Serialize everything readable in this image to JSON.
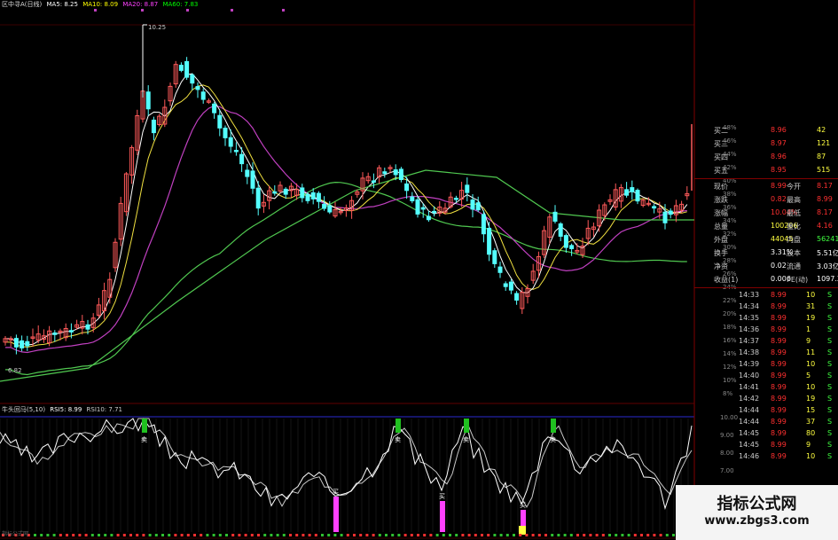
{
  "main_chart": {
    "legend": {
      "name": "区中寻A(日线)",
      "ma5": "MA5: 8.25",
      "ma10": "MA10: 8.09",
      "ma20": "MA20: 8.87",
      "ma60": "MA60: 7.83"
    },
    "high_annotation": "10.25",
    "low_annotation": "6.82",
    "colors": {
      "up": "#ff5a5a",
      "down": "#54ffff",
      "ma5": "#ffffff",
      "ma10": "#f0e040",
      "ma20": "#c040c0",
      "ma60": "#50c850",
      "ma5_label": "#ffffff",
      "ma10_label": "#ffff00",
      "ma20_label": "#ff40ff",
      "ma60_label": "#00ff00"
    }
  },
  "pct_axis": [
    "48%",
    "46%",
    "44%",
    "42%",
    "40%",
    "38%",
    "36%",
    "34%",
    "32%",
    "30%",
    "28%",
    "26%",
    "24%",
    "22%",
    "20%",
    "18%",
    "16%",
    "14%",
    "12%",
    "10%",
    "8%"
  ],
  "rsi_axis": [
    "10.00",
    "9.00",
    "8.00",
    "7.00",
    "6.00",
    "5.00"
  ],
  "quote_panel": {
    "bids": [
      {
        "label": "买二",
        "price": "8.96",
        "vol": "42"
      },
      {
        "label": "买三",
        "price": "8.97",
        "vol": "121"
      },
      {
        "label": "买四",
        "price": "8.96",
        "vol": "87"
      },
      {
        "label": "买五",
        "price": "8.95",
        "vol": "515"
      }
    ],
    "stats": [
      {
        "l1": "现价",
        "v1": "8.99",
        "l2": "今开",
        "v2": "8.17"
      },
      {
        "l1": "涨跌",
        "v1": "0.82",
        "l2": "最高",
        "v2": "8.99"
      },
      {
        "l1": "涨幅",
        "v1": "10.04%",
        "l2": "最低",
        "v2": "8.17"
      },
      {
        "l1": "总量",
        "v1": "100206",
        "l2": "量比",
        "v2": "4.16"
      },
      {
        "l1": "外盘",
        "v1": "44045",
        "l2": "内盘",
        "v2": "56241"
      },
      {
        "l1": "换手",
        "v1": "3.31%",
        "l2": "股本",
        "v2": "5.51亿"
      },
      {
        "l1": "净资",
        "v1": "0.02",
        "l2": "流通",
        "v2": "3.03亿"
      },
      {
        "l1": "收益(1)",
        "v1": "0.006",
        "l2": "PE(动)",
        "v2": "1097.2"
      }
    ],
    "ticks": [
      {
        "time": "14:33",
        "price": "8.99",
        "vol": "10",
        "side": "S"
      },
      {
        "time": "14:34",
        "price": "8.99",
        "vol": "31",
        "side": "S"
      },
      {
        "time": "14:35",
        "price": "8.99",
        "vol": "19",
        "side": "S"
      },
      {
        "time": "14:36",
        "price": "8.99",
        "vol": "1",
        "side": "S"
      },
      {
        "time": "14:37",
        "price": "8.99",
        "vol": "9",
        "side": "S"
      },
      {
        "time": "14:38",
        "price": "8.99",
        "vol": "11",
        "side": "S"
      },
      {
        "time": "14:39",
        "price": "8.99",
        "vol": "10",
        "side": "S"
      },
      {
        "time": "14:40",
        "price": "8.99",
        "vol": "5",
        "side": "S"
      },
      {
        "time": "14:41",
        "price": "8.99",
        "vol": "10",
        "side": "S"
      },
      {
        "time": "14:42",
        "price": "8.99",
        "vol": "19",
        "side": "S"
      },
      {
        "time": "14:44",
        "price": "8.99",
        "vol": "15",
        "side": "S"
      },
      {
        "time": "14:44",
        "price": "8.99",
        "vol": "37",
        "side": "S"
      },
      {
        "time": "14:45",
        "price": "8.99",
        "vol": "80",
        "side": "S"
      },
      {
        "time": "14:45",
        "price": "8.99",
        "vol": "9",
        "side": "S"
      },
      {
        "time": "14:46",
        "price": "8.99",
        "vol": "10",
        "side": "S"
      }
    ],
    "colors": {
      "label": "#cccccc",
      "red": "#ff3030",
      "white": "#ffffff",
      "green": "#40ff40",
      "yellow": "#ffff40",
      "magenta": "#ff50ff"
    }
  },
  "rsi_panel": {
    "legend": {
      "name": "牛头回马(5,10)",
      "rsi5": "RSI5: 8.99",
      "rsi10": "RSI10: 7.71"
    },
    "signal_label": "卖",
    "buy_signal_label": "买",
    "colors": {
      "rsi5": "#ffffff",
      "rsi10": "#c8c8c8",
      "sell": "#20c020",
      "buy": "#ff40ff",
      "frame": "#4040ff"
    }
  },
  "bottom_left_label": "指标公式网",
  "watermark": {
    "title": "指标公式网",
    "url": "www.zbgs3.com"
  }
}
